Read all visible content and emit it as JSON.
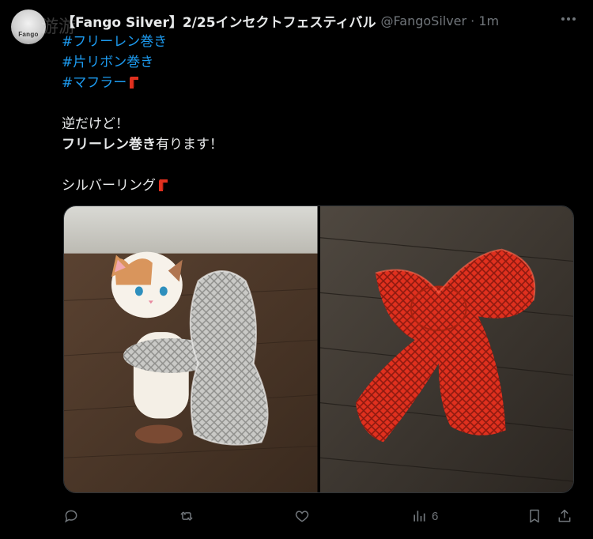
{
  "tweet": {
    "display_name": "【Fango Silver】2/25インセクトフェスティバル",
    "handle": "@FangoSilver · 1m",
    "avatar_text": "Fango",
    "watermark": "游游",
    "hashtags": [
      "#フリーレン巻き",
      "#片リボン巻き",
      "#マフラー"
    ],
    "line1": "逆だけど！",
    "line2_bold": "フリーレン巻き",
    "line2_rest": "有ります！",
    "line3": "シルバーリング",
    "scarf_emoji": "scarf-emoji"
  },
  "media": {
    "left_alt": "silver-knit-scarf-ring-on-cat-figure",
    "right_alt": "red-knit-scarf-ring-on-wood"
  },
  "actions": {
    "reply_icon": "reply-icon",
    "retweet_icon": "retweet-icon",
    "like_icon": "heart-icon",
    "views_icon": "views-icon",
    "views_count": "6",
    "bookmark_icon": "bookmark-icon",
    "share_icon": "share-icon"
  },
  "colors": {
    "background": "#000000",
    "text": "#e7e9ea",
    "muted": "#71767b",
    "link": "#1d9bf0",
    "scarf_red": "#e0301e"
  }
}
